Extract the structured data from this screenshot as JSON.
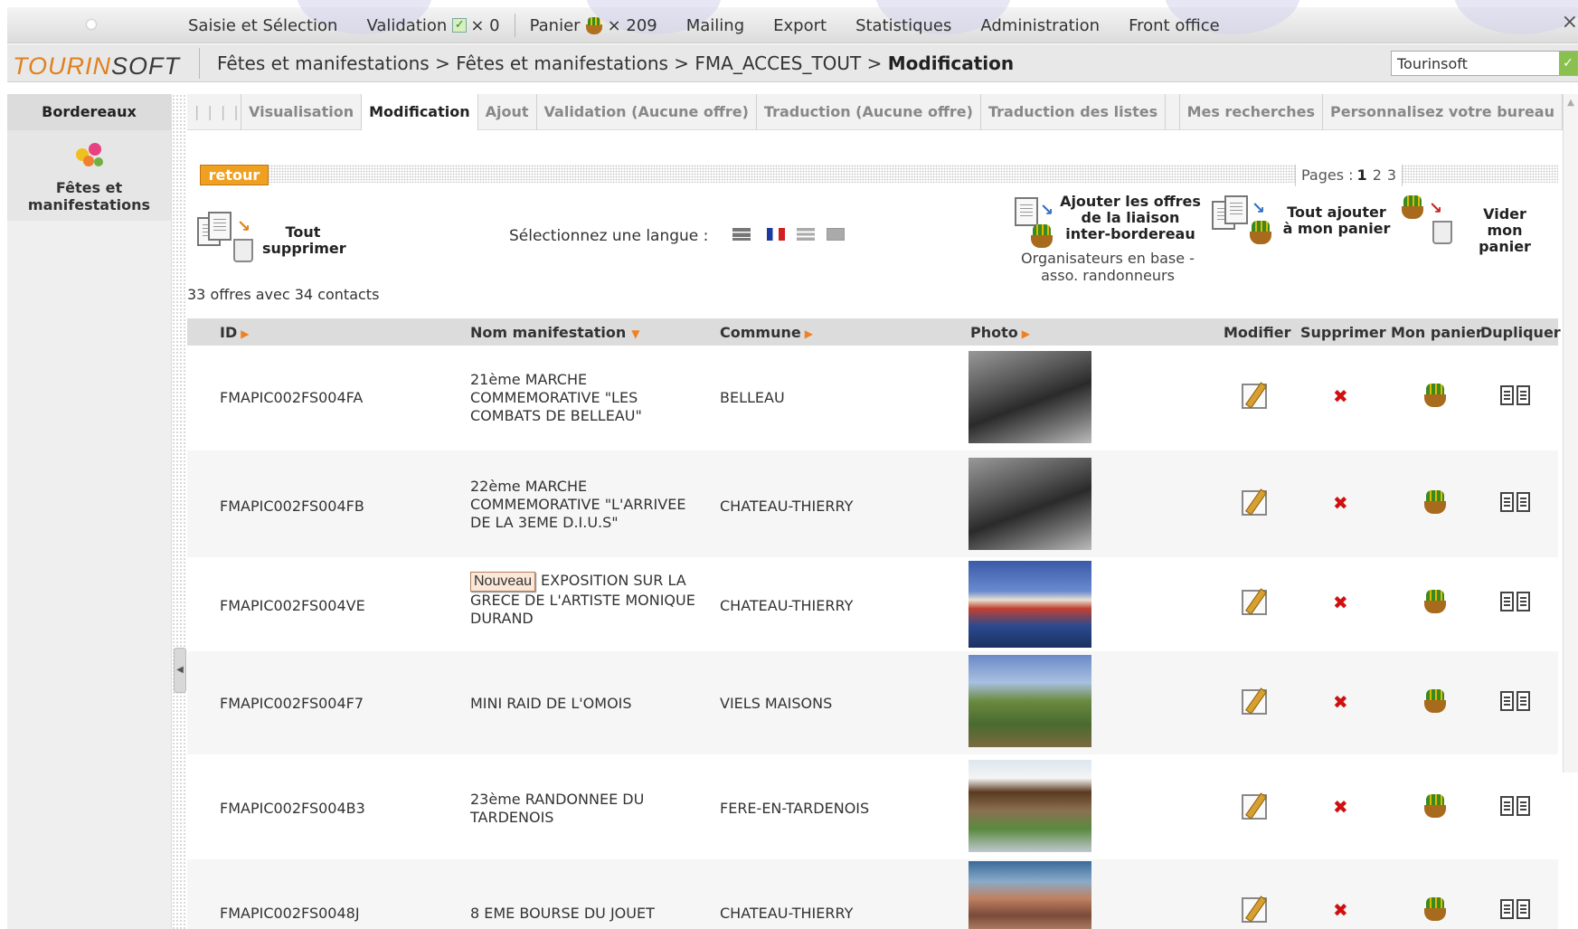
{
  "topmenu": {
    "items": [
      {
        "label": "Saisie et Sélection"
      },
      {
        "label": "Validation",
        "count": "× 0"
      },
      {
        "label": "Panier",
        "count": "× 209"
      },
      {
        "label": "Mailing"
      },
      {
        "label": "Export"
      },
      {
        "label": "Statistiques"
      },
      {
        "label": "Administration"
      },
      {
        "label": "Front office"
      }
    ],
    "close": "×"
  },
  "header": {
    "logo_a": "TOURIN",
    "logo_b": "SOFT",
    "breadcrumb": [
      "Fêtes et manifestations",
      "Fêtes et manifestations",
      "FMA_ACCES_TOUT",
      "Modification"
    ],
    "breadcrumb_sep": " > ",
    "site_select": "Tourinsoft"
  },
  "sidebar": {
    "title": "Bordereaux",
    "item_label_1": "Fêtes et",
    "item_label_2": "manifestations"
  },
  "tabs": {
    "grip": "| | | |",
    "items": [
      "Visualisation",
      "Modification",
      "Ajout",
      "Validation  (Aucune offre)",
      "Traduction  (Aucune offre)",
      "Traduction des listes",
      "Mes recherches",
      "Personnalisez votre bureau"
    ],
    "active": "Modification"
  },
  "toolbar": {
    "retour": "retour",
    "pages_label": "Pages :",
    "pages": [
      "1",
      "2",
      "3"
    ],
    "current_page": "1",
    "tout_supprimer_1": "Tout",
    "tout_supprimer_2": "supprimer",
    "lang_label": "Sélectionnez une langue :",
    "ajouter_1": "Ajouter les offres",
    "ajouter_2": "de la liaison",
    "ajouter_3": "inter-bordereau",
    "ajouter_note_1": "Organisateurs en base -",
    "ajouter_note_2": "asso. randonneurs",
    "tout_ajouter_1": "Tout ajouter",
    "tout_ajouter_2": "à mon panier",
    "vider_1": "Vider",
    "vider_2": "mon panier",
    "count": "33 offres avec 34 contacts"
  },
  "table": {
    "headers": {
      "id": "ID",
      "nom": "Nom manifestation",
      "commune": "Commune",
      "photo": "Photo",
      "modifier": "Modifier",
      "supprimer": "Supprimer",
      "panier": "Mon panier",
      "dupliquer": "Dupliquer"
    },
    "new_badge": "Nouveau",
    "rows": [
      {
        "id": "FMAPIC002FS004FA",
        "nom": "21ème MARCHE COMMEMORATIVE \"LES COMBATS DE BELLEAU\"",
        "commune": "BELLEAU"
      },
      {
        "id": "FMAPIC002FS004FB",
        "nom": "22ème MARCHE COMMEMORATIVE \"L'ARRIVEE DE LA 3EME D.I.U.S\"",
        "commune": "CHATEAU-THIERRY"
      },
      {
        "id": "FMAPIC002FS004VE",
        "nom": "EXPOSITION SUR LA GRECE DE L'ARTISTE MONIQUE DURAND",
        "commune": "CHATEAU-THIERRY"
      },
      {
        "id": "FMAPIC002FS004F7",
        "nom": "MINI RAID DE L'OMOIS",
        "commune": "VIELS MAISONS"
      },
      {
        "id": "FMAPIC002FS004B3",
        "nom": "23ème RANDONNEE DU TARDENOIS",
        "commune": "FERE-EN-TARDENOIS"
      },
      {
        "id": "FMAPIC002FS0048J",
        "nom": "8 EME BOURSE DU JOUET",
        "commune": "CHATEAU-THIERRY"
      }
    ]
  }
}
